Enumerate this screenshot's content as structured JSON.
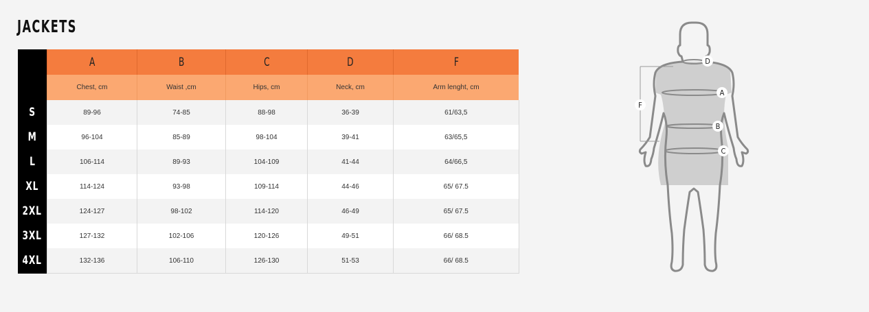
{
  "title": "JACKETS",
  "columns": [
    {
      "letter": "A",
      "label": "Chest, cm"
    },
    {
      "letter": "B",
      "label": "Waist ,cm"
    },
    {
      "letter": "C",
      "label": "Hips, cm"
    },
    {
      "letter": "D",
      "label": "Neck, cm"
    },
    {
      "letter": "F",
      "label": "Arm lenght, cm"
    }
  ],
  "rows": [
    {
      "size": "S",
      "values": [
        "89-96",
        "74-85",
        "88-98",
        "36-39",
        "61/63,5"
      ]
    },
    {
      "size": "M",
      "values": [
        "96-104",
        "85-89",
        "98-104",
        "39-41",
        "63/65,5"
      ]
    },
    {
      "size": "L",
      "values": [
        "106-114",
        "89-93",
        "104-109",
        "41-44",
        "64/66,5"
      ]
    },
    {
      "size": "XL",
      "values": [
        "114-124",
        "93-98",
        "109-114",
        "44-46",
        "65/ 67.5"
      ]
    },
    {
      "size": "2XL",
      "values": [
        "124-127",
        "98-102",
        "114-120",
        "46-49",
        "65/ 67.5"
      ]
    },
    {
      "size": "3XL",
      "values": [
        "127-132",
        "102-106",
        "120-126",
        "49-51",
        "66/ 68.5"
      ]
    },
    {
      "size": "4XL",
      "values": [
        "132-136",
        "106-110",
        "126-130",
        "51-53",
        "66/ 68.5"
      ]
    }
  ],
  "figure": {
    "labels": {
      "a": "A",
      "b": "B",
      "c": "C",
      "d": "D",
      "f": "F"
    }
  }
}
